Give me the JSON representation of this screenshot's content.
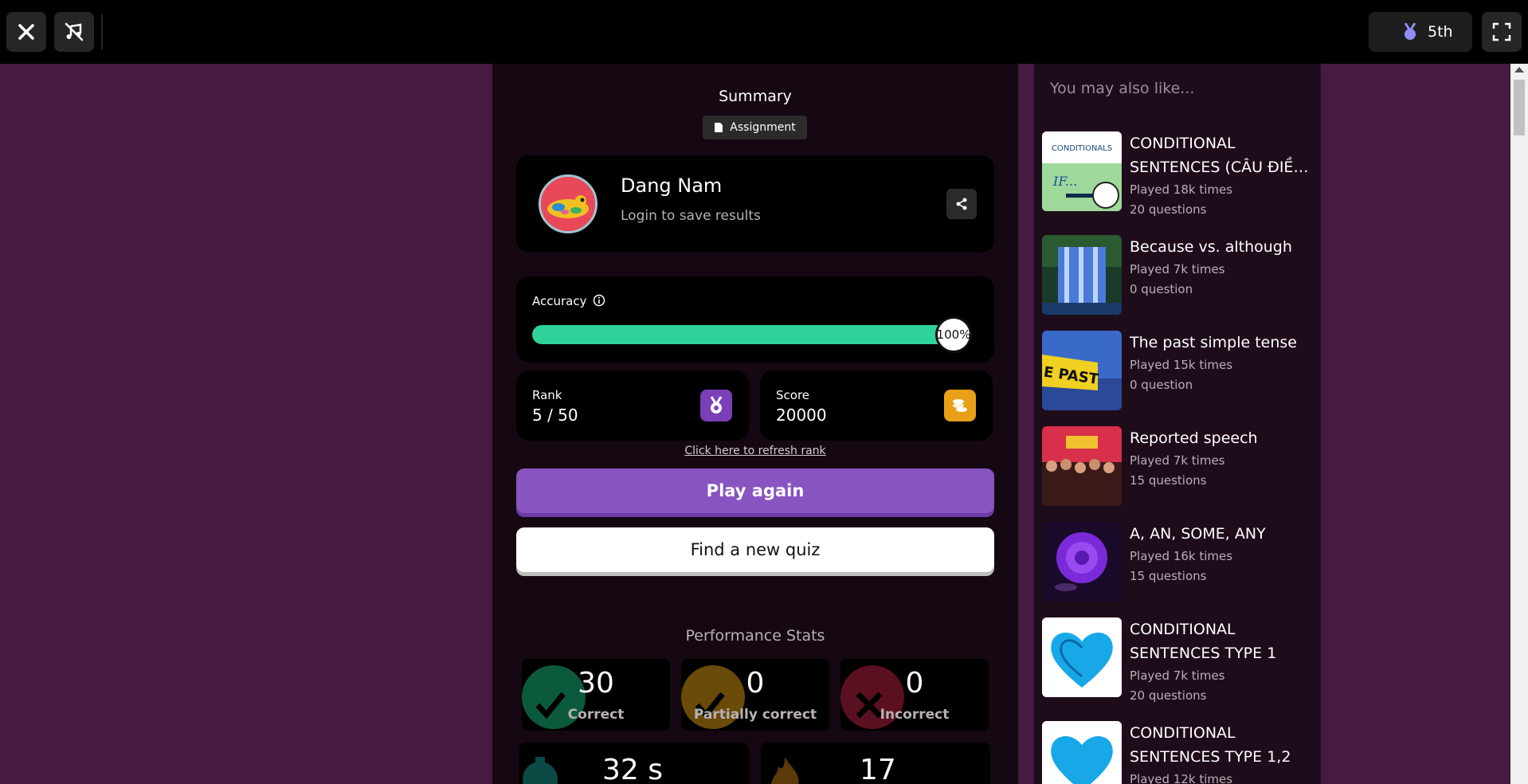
{
  "topbar": {
    "rank_pill": "5th"
  },
  "summary": {
    "title": "Summary",
    "badge": "Assignment"
  },
  "profile": {
    "name": "Dang Nam",
    "subtitle": "Login to save results"
  },
  "accuracy": {
    "label": "Accuracy",
    "value_text": "100%",
    "value": 1.0
  },
  "rank": {
    "label": "Rank",
    "value": "5 / 50"
  },
  "score": {
    "label": "Score",
    "value": "20000"
  },
  "refresh_link": "Click here to refresh rank",
  "buttons": {
    "play_again": "Play again",
    "find_quiz": "Find a new quiz"
  },
  "performance": {
    "title": "Performance Stats",
    "boxes": [
      {
        "num": "30",
        "label": "Correct",
        "color": "#0c5a3c"
      },
      {
        "num": "0",
        "label": "Partially correct",
        "color": "#6a4a08"
      },
      {
        "num": "0",
        "label": "Incorrect",
        "color": "#5a1020"
      }
    ],
    "bottom": [
      {
        "num": "32 s"
      },
      {
        "num": "17"
      }
    ]
  },
  "rail": {
    "title": "You may also like...",
    "items": [
      {
        "title": "CONDITIONAL",
        "title2": "SENTENCES (CÂU ĐIỀU...",
        "played": "Played 18k times",
        "questions": "20 questions",
        "thumb_label": "CONDITIONALS",
        "thumb_text": "IF..."
      },
      {
        "title": "Because vs. although",
        "played": "Played 7k times",
        "questions": "0 question"
      },
      {
        "title": "The past simple tense",
        "played": "Played 15k times",
        "questions": "0 question",
        "thumb_text": "E PAST"
      },
      {
        "title": "Reported speech",
        "played": "Played 7k times",
        "questions": "15 questions"
      },
      {
        "title": "A, AN, SOME, ANY",
        "played": "Played 16k times",
        "questions": "15 questions"
      },
      {
        "title": "CONDITIONAL",
        "title2": "SENTENCES TYPE 1",
        "played": "Played 7k times",
        "questions": "20 questions"
      },
      {
        "title": "CONDITIONAL",
        "title2": "SENTENCES TYPE 1,2",
        "played": "Played 12k times"
      }
    ]
  },
  "colors": {
    "accent_purple": "#8854c0",
    "accuracy_green": "#2fd39a",
    "background": "#461a42"
  }
}
